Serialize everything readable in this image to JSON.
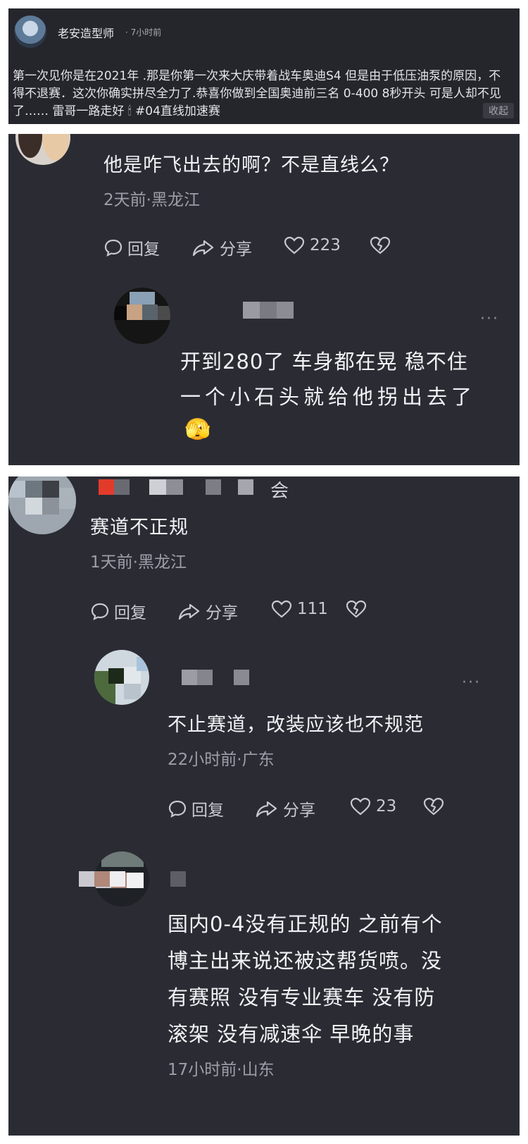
{
  "post": {
    "author": "老安造型师",
    "time": "· 7小时前",
    "body": "第一次见你是在2021年 .那是你第一次来大庆带着战车奥迪S4 但是由于低压油泵的原因，不得不退赛．这次你确实拼尽全力了.恭喜你做到全国奥迪前三名 0-400 8秒开头 可是人却不见了…… 雷哥一路走好 🕯 #04直线加速赛",
    "fold_label": "收起"
  },
  "comment1": {
    "text": "他是咋飞出去的啊？不是直线么？",
    "meta": "2天前·黑龙江",
    "reply": "回复",
    "share": "分享",
    "likes": "223",
    "reply1": {
      "text_line1": "开到280了 车身都在晃 稳不住",
      "text_line2": "一个小石头就给他拐出去了",
      "emoji": "🫣",
      "more": "···"
    }
  },
  "comment2": {
    "name_suffix": "会",
    "text": "赛道不正规",
    "meta": "1天前·黑龙江",
    "reply": "回复",
    "share": "分享",
    "likes": "111",
    "reply1": {
      "text": "不止赛道，改装应该也不规范",
      "meta": "22小时前·广东",
      "reply": "回复",
      "share": "分享",
      "likes": "23",
      "more": "···"
    },
    "reply2": {
      "line1": "国内0-4没有正规的 之前有个",
      "line2": "博主出来说还被这帮货喷。没",
      "line3": "有赛照 没有专业赛车 没有防",
      "line4": "滚架 没有减速伞 早晚的事",
      "meta": "17小时前·山东"
    }
  },
  "colors": {
    "panel_bg": "#2b2c33",
    "top_panel_bg": "#25262c",
    "primary_text": "#f2f2f6",
    "meta_text": "#9d9ea7"
  }
}
